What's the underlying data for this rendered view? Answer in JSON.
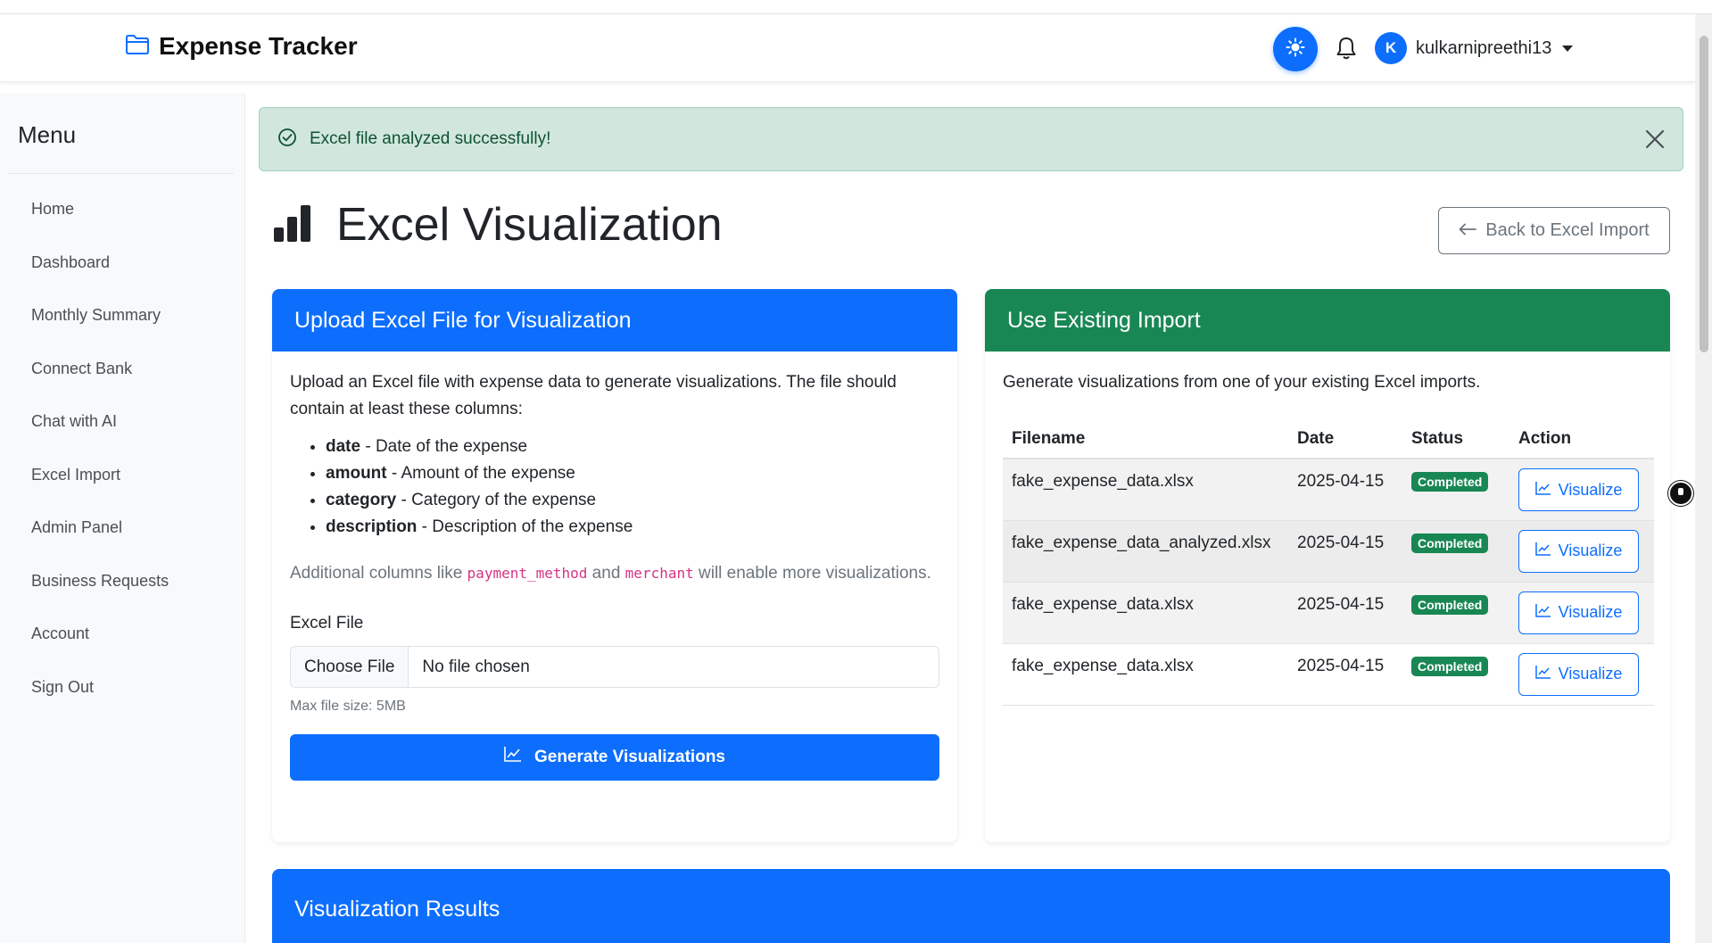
{
  "brand": {
    "title": "Expense Tracker"
  },
  "user": {
    "initial": "K",
    "name": "kulkarnipreethi13"
  },
  "sidebar": {
    "title": "Menu",
    "items": [
      {
        "label": "Home"
      },
      {
        "label": "Dashboard"
      },
      {
        "label": "Monthly Summary"
      },
      {
        "label": "Connect Bank"
      },
      {
        "label": "Chat with AI"
      },
      {
        "label": "Excel Import"
      },
      {
        "label": "Admin Panel"
      },
      {
        "label": "Business Requests"
      },
      {
        "label": "Account"
      },
      {
        "label": "Sign Out"
      }
    ]
  },
  "alert": {
    "message": "Excel file analyzed successfully!"
  },
  "page": {
    "title": "Excel Visualization",
    "back_label": "Back to Excel Import"
  },
  "upload": {
    "header": "Upload Excel File for Visualization",
    "intro": "Upload an Excel file with expense data to generate visualizations. The file should contain at least these columns:",
    "columns": [
      {
        "name": "date",
        "desc": " - Date of the expense"
      },
      {
        "name": "amount",
        "desc": " - Amount of the expense"
      },
      {
        "name": "category",
        "desc": " - Category of the expense"
      },
      {
        "name": "description",
        "desc": " - Description of the expense"
      }
    ],
    "extra_prefix": "Additional columns like ",
    "extra_code1": "payment_method",
    "extra_and": " and ",
    "extra_code2": "merchant",
    "extra_suffix": " will enable more visualizations.",
    "file_label": "Excel File",
    "choose_label": "Choose File",
    "no_file": "No file chosen",
    "hint": "Max file size: 5MB",
    "generate_label": "Generate Visualizations"
  },
  "existing": {
    "header": "Use Existing Import",
    "desc": "Generate visualizations from one of your existing Excel imports.",
    "columns": [
      "Filename",
      "Date",
      "Status",
      "Action"
    ],
    "rows": [
      {
        "filename": "fake_expense_data.xlsx",
        "date": "2025-04-15",
        "status": "Completed",
        "action": "Visualize"
      },
      {
        "filename": "fake_expense_data_analyzed.xlsx",
        "date": "2025-04-15",
        "status": "Completed",
        "action": "Visualize"
      },
      {
        "filename": "fake_expense_data.xlsx",
        "date": "2025-04-15",
        "status": "Completed",
        "action": "Visualize"
      },
      {
        "filename": "fake_expense_data.xlsx",
        "date": "2025-04-15",
        "status": "Completed",
        "action": "Visualize"
      }
    ]
  },
  "results": {
    "header": "Visualization Results"
  },
  "colors": {
    "primary": "#0d6efd",
    "success": "#198754",
    "alert_bg": "#d1e7dd",
    "alert_text": "#0f5132"
  }
}
